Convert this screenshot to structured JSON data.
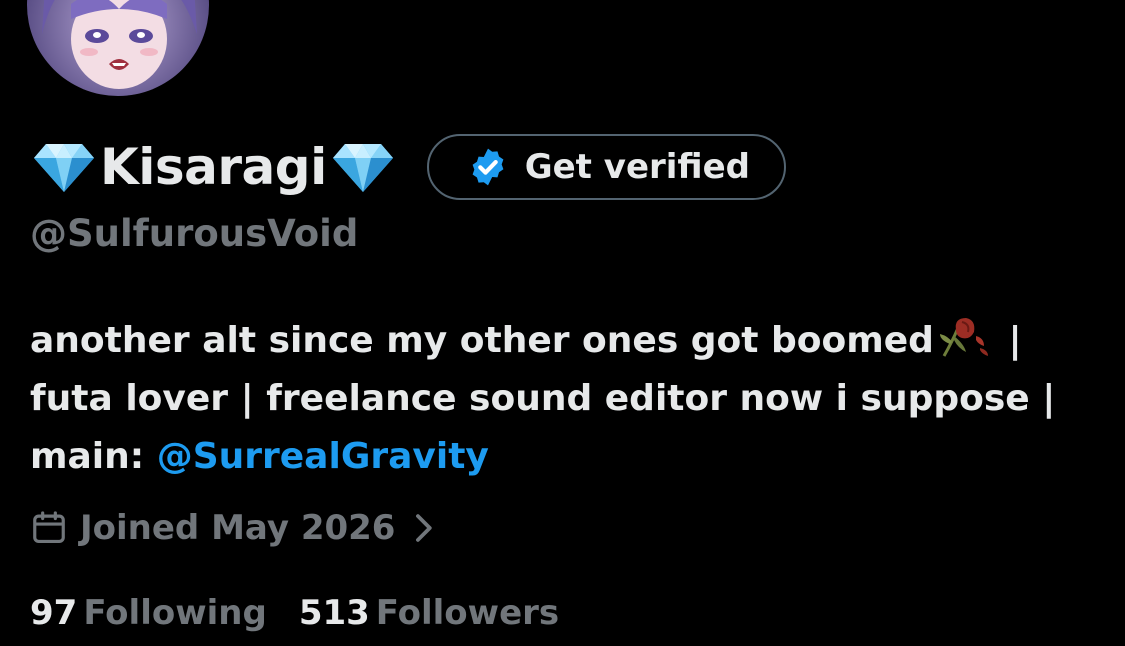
{
  "profile": {
    "display_name": "Kisaragi",
    "handle": "@SulfurousVoid",
    "name_decor_icon": "diamond-icon"
  },
  "verify_button": {
    "label": "Get verified",
    "icon": "verified-badge-icon"
  },
  "bio": {
    "line1_text": "another alt since my other ones got boomed",
    "line1_after_emoji": " |",
    "line1_emoji": "wilted-rose-icon",
    "line2_text": "futa lover | freelance sound editor now i suppose |",
    "line3_prefix": "main: ",
    "line3_mention": "@SurrealGravity"
  },
  "joined": {
    "label": "Joined May 2026",
    "icon": "calendar-icon",
    "chevron_icon": "chevron-right-icon"
  },
  "stats": {
    "following_count": "97",
    "following_label": "Following",
    "followers_count": "513",
    "followers_label": "Followers"
  },
  "colors": {
    "background": "#000000",
    "primary_text": "#e7e9ea",
    "secondary_text": "#71767b",
    "link": "#1d9bf0",
    "button_border": "#536471"
  }
}
